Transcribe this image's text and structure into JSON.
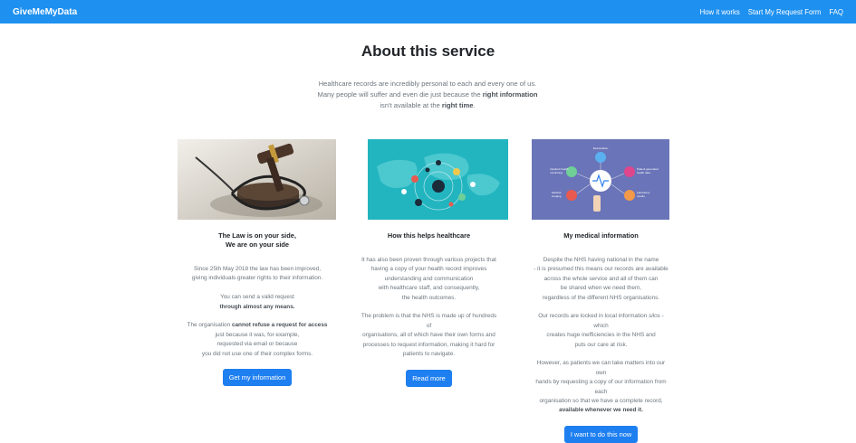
{
  "nav": {
    "brand": "GiveMeMyData",
    "links": [
      "How it works",
      "Start My Request Form",
      "FAQ"
    ]
  },
  "hero": {
    "title": "About this service",
    "intro_line1": "Healthcare records are incredibly personal to each and every one of us.",
    "intro_line2a": "Many people will suffer and even die just because the ",
    "intro_line2b": "right information",
    "intro_line3a": "isn't available at the ",
    "intro_line3b": "right time",
    "intro_line3c": "."
  },
  "cards": [
    {
      "title_line1": "The Law is on your side,",
      "title_line2": "We are on your side",
      "p1_line1": "Since 25th May 2018 the law has been improved,",
      "p1_line2": "giving individuals greater rights to their information.",
      "p2_line1": "You can send a valid request",
      "p2_line2": "through almost any means.",
      "p3_line1a": "The organisation ",
      "p3_line1b": "cannot refuse a request for access",
      "p3_line2": "just because it was, for example,",
      "p3_line3": "requested via email or because",
      "p3_line4": "you did not use one of their complex forms.",
      "button": "Get my information"
    },
    {
      "title": "How this helps healthcare",
      "p1_line1": "It has also been proven through various projects that",
      "p1_line2": "having a copy of your health record improves",
      "p1_line3": "understanding and communication",
      "p1_line4": "with healthcare staff, and consequently,",
      "p1_line5": "the health outcomes.",
      "p2_line1": "The problem is that the NHS is made up of hundreds of",
      "p2_line2": "organisations, all of which have their own forms and",
      "p2_line3": "processes to request information, making it hard for",
      "p2_line4": "patients to navigate.",
      "button": "Read more"
    },
    {
      "title": "My medical information",
      "p1_line1": "Despite the NHS having national in the name",
      "p1_line2": "- it is presumed this means our records are available",
      "p1_line3": "across the whole service and all of them can",
      "p1_line4": "be shared when we need them,",
      "p1_line5": "regardless of the different NHS organisations.",
      "p2_line1a": "Our records are locked in local information ",
      "p2_line1b": "silos",
      "p2_line1c": " - which",
      "p2_line2": "creates huge inefficiencies in the NHS and",
      "p2_line3": "puts our care at risk.",
      "p3_line1": "However, as patients we can take matters into our own",
      "p3_line2": "hands by requesting a copy of our information from each",
      "p3_line3": "organisation so that we have a complete record,",
      "p3_line4": "available whenever we need it.",
      "button": "I want to do this now",
      "diagram": {
        "examination": "Examination",
        "inpatient": "Inpatient health",
        "monitoring": "monitoring",
        "patient_gen": "Patient generated",
        "health_data": "health data",
        "medical": "Medical",
        "imaging": "imaging",
        "laboratory": "Laboratory",
        "results": "results"
      }
    }
  ],
  "colors": {
    "navbar": "#1e90f0",
    "button": "#1e7ff0",
    "teal_panel": "#22b5c0",
    "purple_panel": "#6a74b8"
  }
}
